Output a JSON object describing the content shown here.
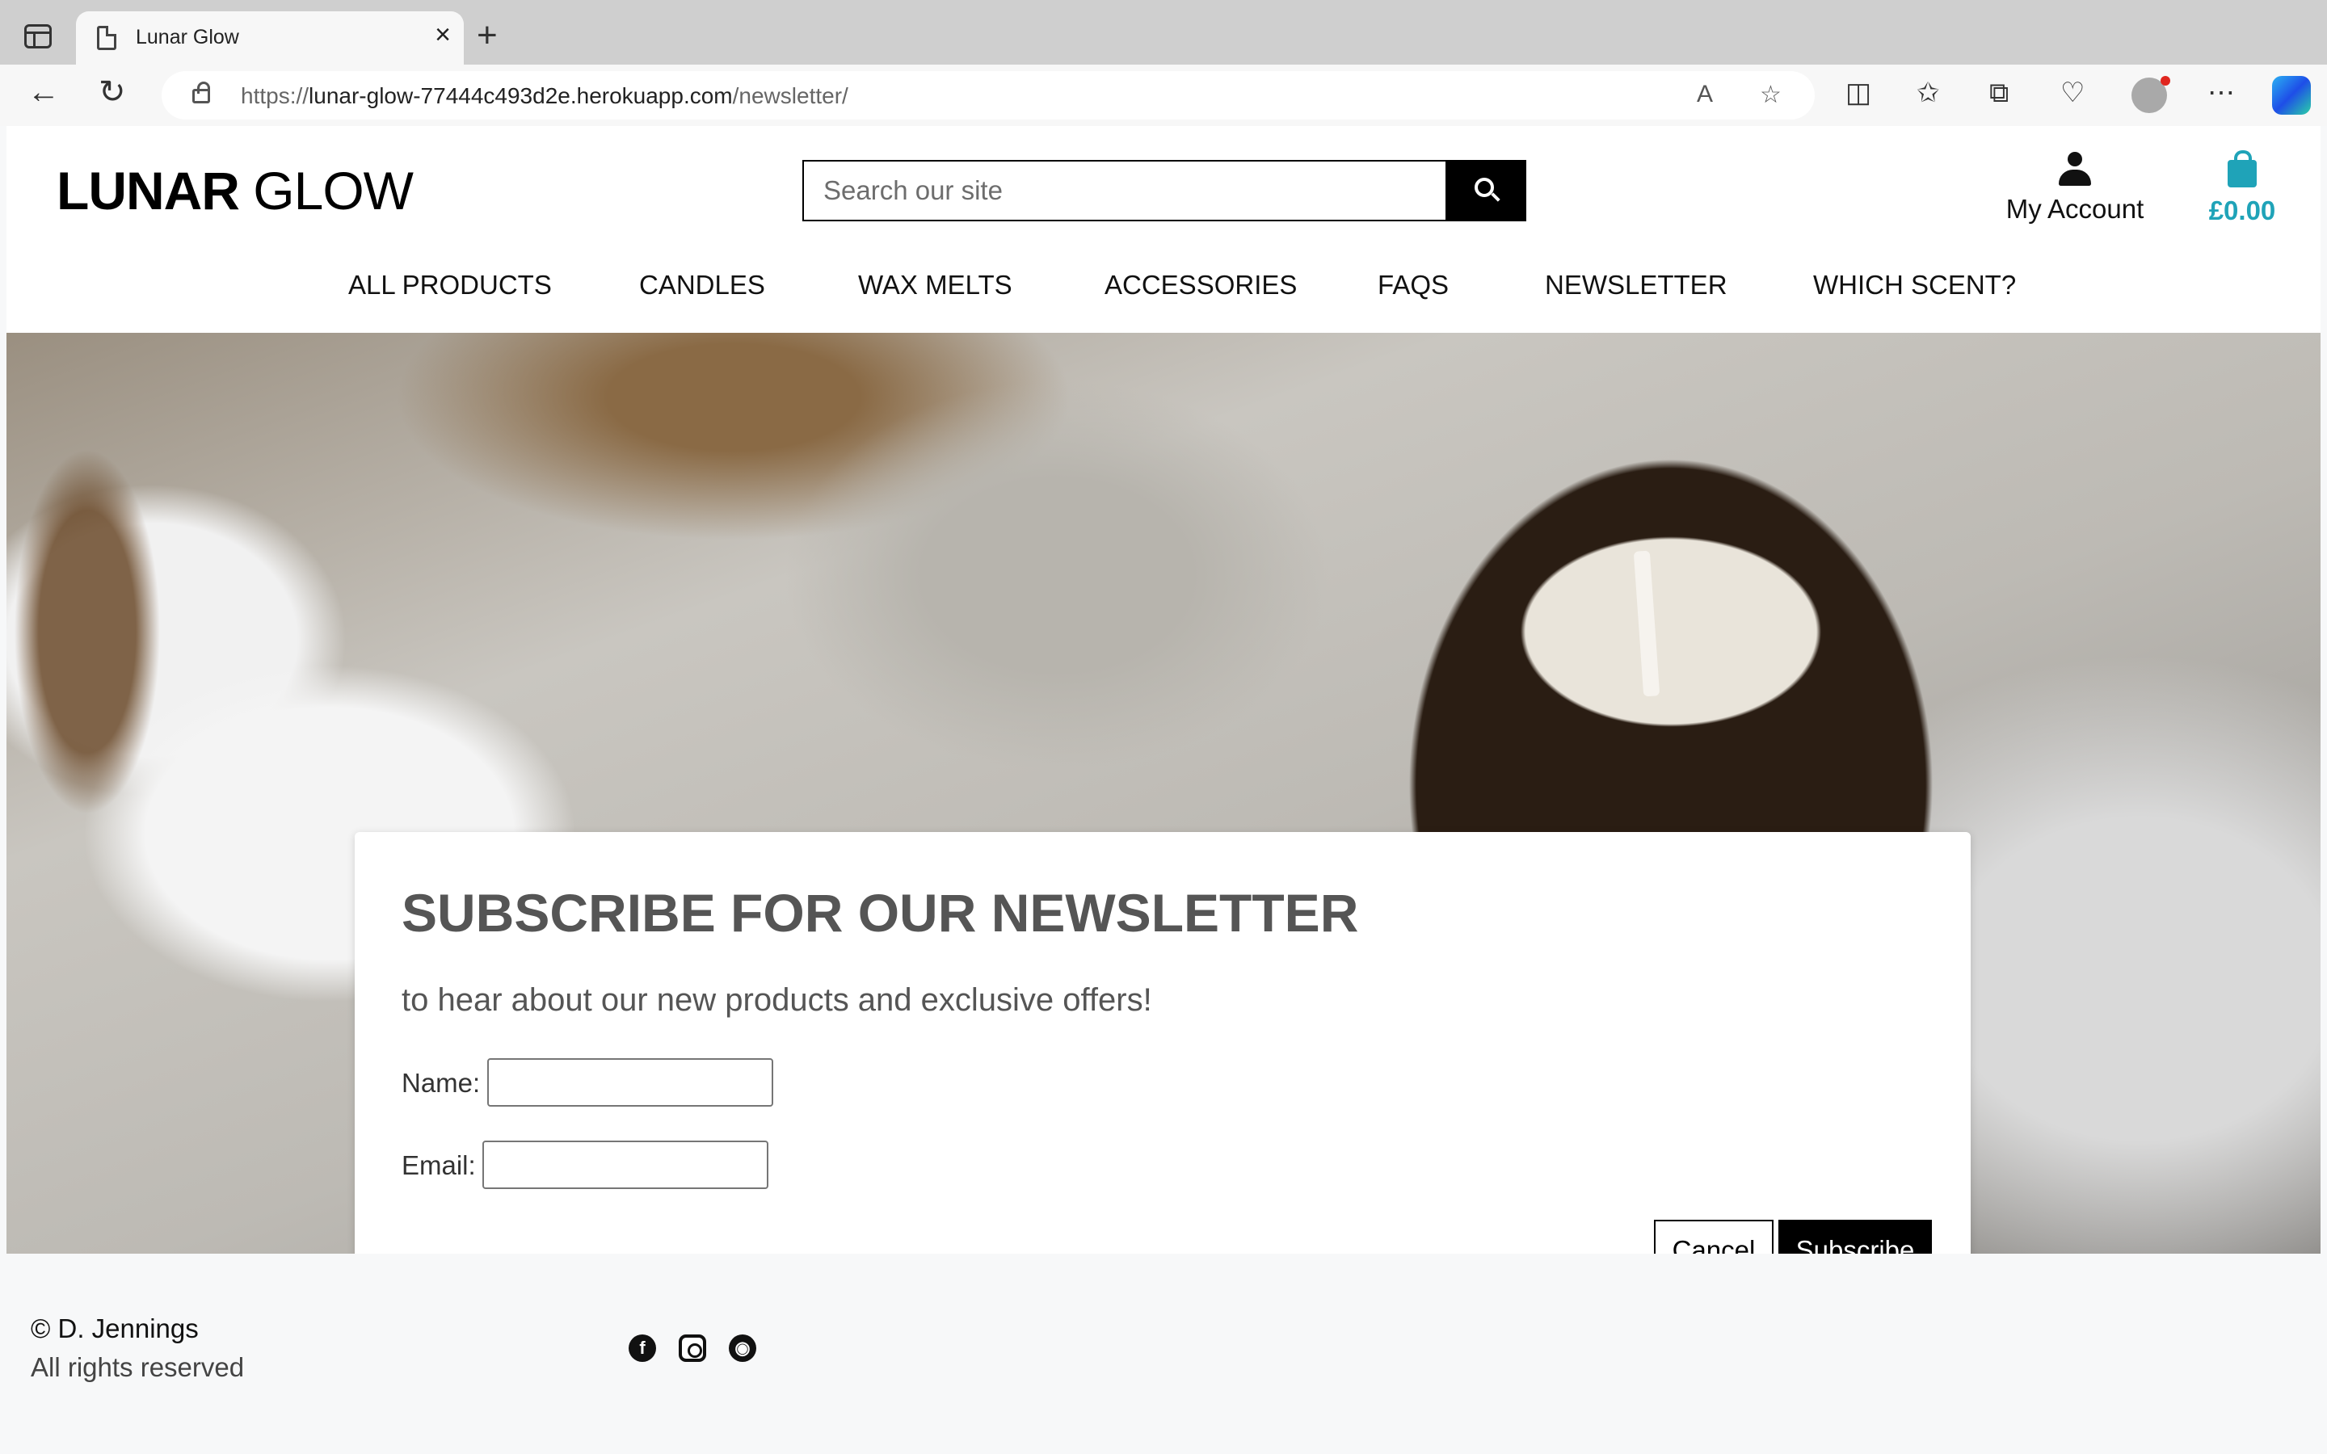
{
  "browser": {
    "tab_title": "Lunar Glow",
    "url_prefix": "https://",
    "url_host": "lunar-glow-77444c493d2e.herokuapp.com",
    "url_path": "/newsletter/"
  },
  "header": {
    "logo_bold": "LUNAR",
    "logo_light": " GLOW",
    "search_placeholder": "Search our site",
    "account_label": "My Account",
    "bag_total": "£0.00"
  },
  "nav": {
    "items": [
      "ALL PRODUCTS",
      "CANDLES",
      "WAX MELTS",
      "ACCESSORIES",
      "FAQS",
      "NEWSLETTER",
      "WHICH SCENT?"
    ]
  },
  "newsletter": {
    "title": "SUBSCRIBE FOR OUR NEWSLETTER",
    "subtitle": "to hear about our new products and exclusive offers!",
    "name_label": "Name:",
    "email_label": "Email:",
    "name_value": "",
    "email_value": "",
    "cancel_label": "Cancel",
    "subscribe_label": "Subscribe"
  },
  "footer": {
    "copyright": "© D. Jennings",
    "rights": "All rights reserved",
    "social_icons": [
      "facebook-icon",
      "instagram-icon",
      "github-icon"
    ]
  },
  "colors": {
    "accent": "#1fa3b8",
    "primary": "#000000"
  }
}
